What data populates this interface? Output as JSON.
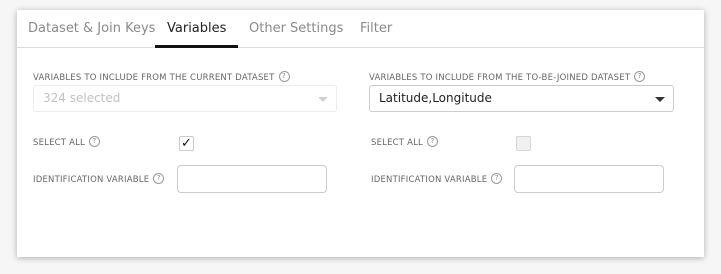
{
  "tabs": [
    {
      "label": "Dataset & Join Keys"
    },
    {
      "label": "Variables"
    },
    {
      "label": "Other Settings"
    },
    {
      "label": "Filter"
    }
  ],
  "active_tab": "Variables",
  "help_glyph": "?",
  "left": {
    "variables_label": "VARIABLES TO INCLUDE FROM THE CURRENT DATASET",
    "variables_value": "324 selected",
    "select_all_label": "SELECT ALL",
    "select_all_checked": true,
    "check_glyph": "✓",
    "id_var_label": "IDENTIFICATION VARIABLE",
    "id_var_value": ""
  },
  "right": {
    "variables_label": "VARIABLES TO INCLUDE FROM THE TO-BE-JOINED DATASET",
    "variables_value": "Latitude,Longitude",
    "select_all_label": "SELECT ALL",
    "select_all_checked": false,
    "id_var_label": "IDENTIFICATION VARIABLE",
    "id_var_value": ""
  }
}
